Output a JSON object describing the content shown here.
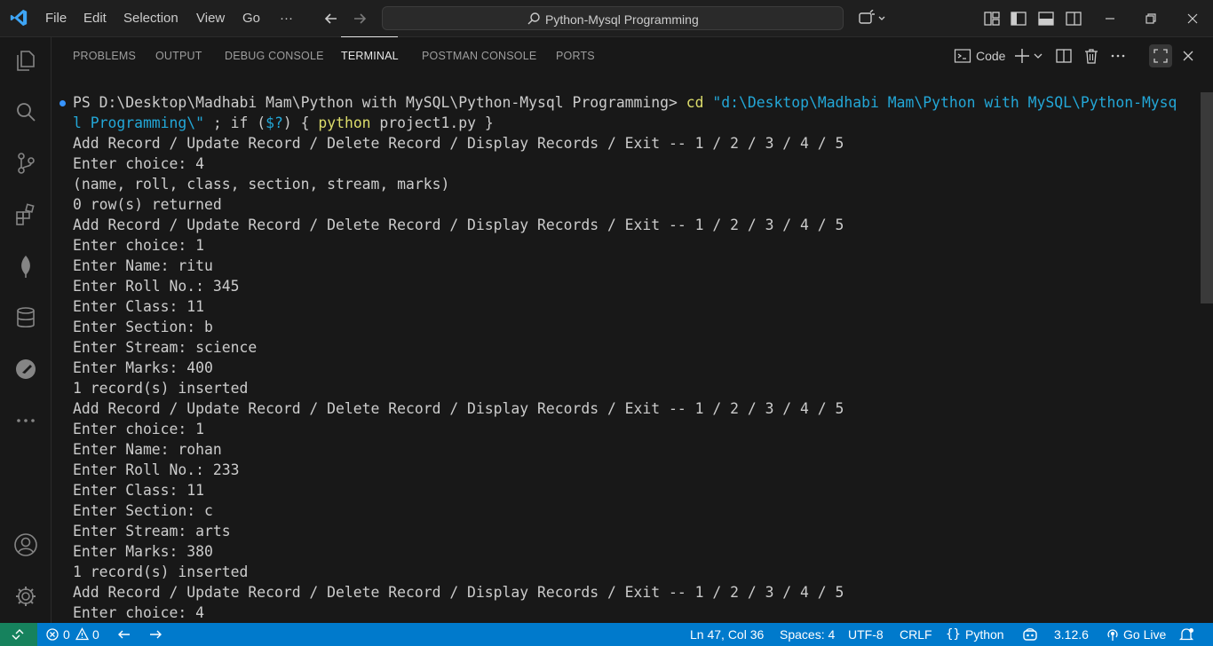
{
  "titlebar": {
    "menus": [
      "File",
      "Edit",
      "Selection",
      "View",
      "Go",
      "···"
    ],
    "search_text": "Python-Mysql Programming"
  },
  "panel": {
    "tabs": [
      "PROBLEMS",
      "OUTPUT",
      "DEBUG CONSOLE",
      "TERMINAL",
      "POSTMAN CONSOLE",
      "PORTS"
    ],
    "active_tab": "TERMINAL",
    "terminal_name": "Code"
  },
  "terminal": {
    "prompt": "PS D:\\Desktop\\Madhabi Mam\\Python with MySQL\\Python-Mysql Programming>",
    "cmd_cd": "cd",
    "cmd_path_line1": "\"d:\\Desktop\\Madhabi Mam\\Python with MySQL\\Python-Mysq",
    "cmd_path_line2": "l Programming\\\"",
    "cmd_semicolon": " ; if (",
    "cmd_var": "$?",
    "cmd_rest": ") { ",
    "cmd_python": "python",
    "cmd_file": " project1.py }",
    "lines": [
      "Add Record / Update Record / Delete Record / Display Records / Exit -- 1 / 2 / 3 / 4 / 5",
      "Enter choice: 4",
      "(name, roll, class, section, stream, marks)",
      "0 row(s) returned",
      "Add Record / Update Record / Delete Record / Display Records / Exit -- 1 / 2 / 3 / 4 / 5",
      "Enter choice: 1",
      "Enter Name: ritu",
      "Enter Roll No.: 345",
      "Enter Class: 11",
      "Enter Section: b",
      "Enter Stream: science",
      "Enter Marks: 400",
      "1 record(s) inserted",
      "Add Record / Update Record / Delete Record / Display Records / Exit -- 1 / 2 / 3 / 4 / 5",
      "Enter choice: 1",
      "Enter Name: rohan",
      "Enter Roll No.: 233",
      "Enter Class: 11",
      "Enter Section: c",
      "Enter Stream: arts",
      "Enter Marks: 380",
      "1 record(s) inserted",
      "Add Record / Update Record / Delete Record / Display Records / Exit -- 1 / 2 / 3 / 4 / 5",
      "Enter choice: 4"
    ]
  },
  "statusbar": {
    "errors": "0",
    "warnings": "0",
    "position": "Ln 47, Col 36",
    "spaces": "Spaces: 4",
    "encoding": "UTF-8",
    "eol": "CRLF",
    "language": "Python",
    "python_version": "3.12.6",
    "go_live": "Go Live"
  },
  "colors": {
    "accent": "#007acc",
    "remote": "#16825d",
    "background": "#181818"
  }
}
